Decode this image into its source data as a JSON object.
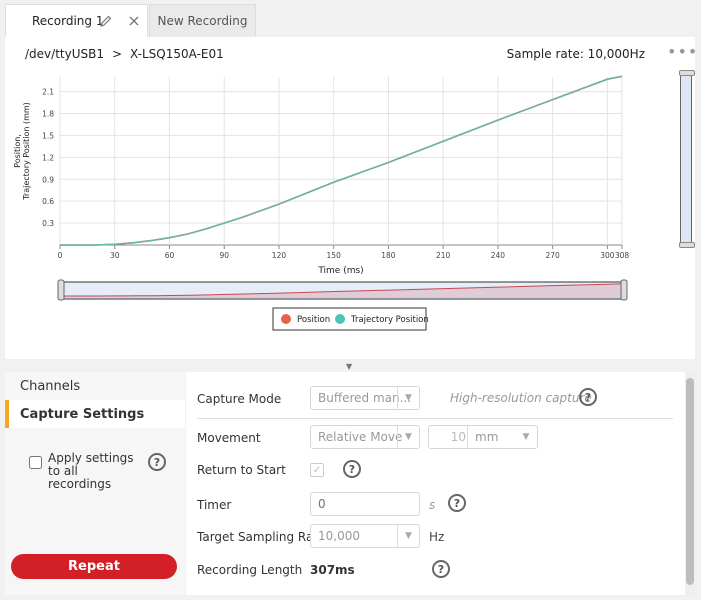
{
  "tabs": [
    {
      "label": "Recording 1",
      "active": true
    },
    {
      "label": "New Recording",
      "active": false
    }
  ],
  "icons": {
    "edit": "pencil-icon",
    "close": "close-icon",
    "more": "more-horizontal-icon"
  },
  "device": {
    "port": "/dev/ttyUSB1",
    "separator": ">",
    "name": "X-LSQ150A-E01"
  },
  "sample_rate": "Sample rate: 10,000Hz",
  "chart_data": {
    "type": "line",
    "ylabel": "Position,\nTrajectory Position (mm)",
    "ylabel_lines": [
      "Position,",
      "Trajectory Position (mm)"
    ],
    "xlabel": "Time (ms)",
    "x_ticks": [
      "0",
      "30",
      "60",
      "90",
      "120",
      "150",
      "180",
      "210",
      "240",
      "270",
      "300",
      "308"
    ],
    "y_ticks": [
      "0.3",
      "0.6",
      "0.9",
      "1.2",
      "1.5",
      "1.8",
      "2.1"
    ],
    "xlim": [
      0,
      308
    ],
    "ylim": [
      0,
      2.3
    ],
    "grid": true,
    "legend_position": "bottom",
    "series": [
      {
        "name": "Position",
        "color": "#e8624a",
        "x": [
          0,
          20,
          30,
          40,
          50,
          60,
          70,
          80,
          90,
          100,
          120,
          150,
          180,
          210,
          240,
          270,
          300,
          308
        ],
        "y": [
          0,
          0,
          0.01,
          0.03,
          0.06,
          0.1,
          0.15,
          0.22,
          0.3,
          0.38,
          0.56,
          0.86,
          1.13,
          1.42,
          1.71,
          1.99,
          2.27,
          2.31
        ]
      },
      {
        "name": "Trajectory Position",
        "color": "#4fc4b4",
        "x": [
          0,
          20,
          30,
          40,
          50,
          60,
          70,
          80,
          90,
          100,
          120,
          150,
          180,
          210,
          240,
          270,
          300,
          308
        ],
        "y": [
          0,
          0,
          0.01,
          0.03,
          0.06,
          0.1,
          0.15,
          0.22,
          0.3,
          0.38,
          0.56,
          0.86,
          1.13,
          1.42,
          1.71,
          1.99,
          2.27,
          2.31
        ]
      }
    ],
    "navigator_color": "#c44a52"
  },
  "left_nav": {
    "items": [
      {
        "label": "Channels",
        "active": false
      },
      {
        "label": "Capture Settings",
        "active": true
      }
    ],
    "apply_label": "Apply settings to all recordings",
    "apply_checked": false,
    "repeat_label": "Repeat"
  },
  "settings": {
    "capture_mode": {
      "label": "Capture Mode",
      "value": "Buffered man...",
      "note": "High-resolution capture"
    },
    "movement": {
      "label": "Movement",
      "value": "Relative Move",
      "distance": "10",
      "unit": "mm"
    },
    "return_to_start": {
      "label": "Return to Start",
      "checked": true
    },
    "timer": {
      "label": "Timer",
      "placeholder": "0",
      "unit": "s"
    },
    "target_rate": {
      "label": "Target Sampling Rate",
      "value": "10,000",
      "unit": "Hz"
    },
    "recording_length": {
      "label": "Recording Length",
      "value": "307ms"
    },
    "help_glyph": "?"
  },
  "colors": {
    "accent": "#f5a623",
    "repeat": "#d32027"
  }
}
